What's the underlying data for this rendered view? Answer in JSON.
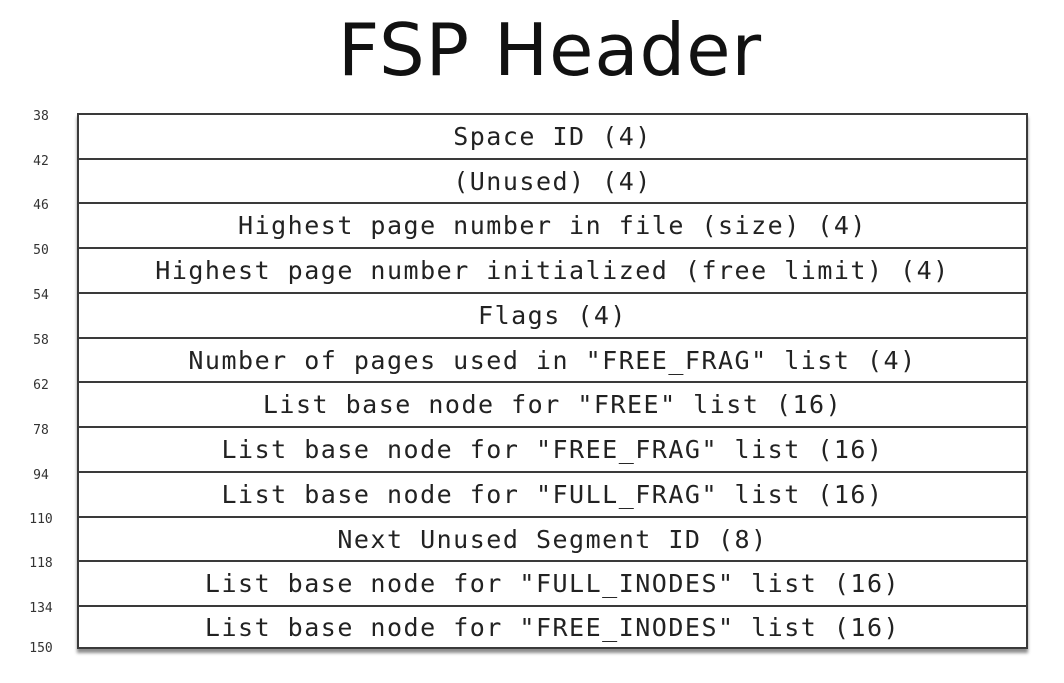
{
  "title": "FSP Header",
  "fields": [
    {
      "offset": "38",
      "label": "Space ID (4)"
    },
    {
      "offset": "42",
      "label": "(Unused) (4)"
    },
    {
      "offset": "46",
      "label": "Highest page number in file (size) (4)"
    },
    {
      "offset": "50",
      "label": "Highest page number initialized (free limit) (4)"
    },
    {
      "offset": "54",
      "label": "Flags (4)"
    },
    {
      "offset": "58",
      "label": "Number of pages used in \"FREE_FRAG\" list (4)"
    },
    {
      "offset": "62",
      "label": "List base node for \"FREE\" list (16)"
    },
    {
      "offset": "78",
      "label": "List base node for \"FREE_FRAG\" list (16)"
    },
    {
      "offset": "94",
      "label": "List base node for \"FULL_FRAG\" list (16)"
    },
    {
      "offset": "110",
      "label": "Next Unused Segment ID (8)"
    },
    {
      "offset": "118",
      "label": "List base node for \"FULL_INODES\" list (16)"
    },
    {
      "offset": "134",
      "label": "List base node for \"FREE_INODES\" list (16)"
    }
  ],
  "end_offset": "150"
}
